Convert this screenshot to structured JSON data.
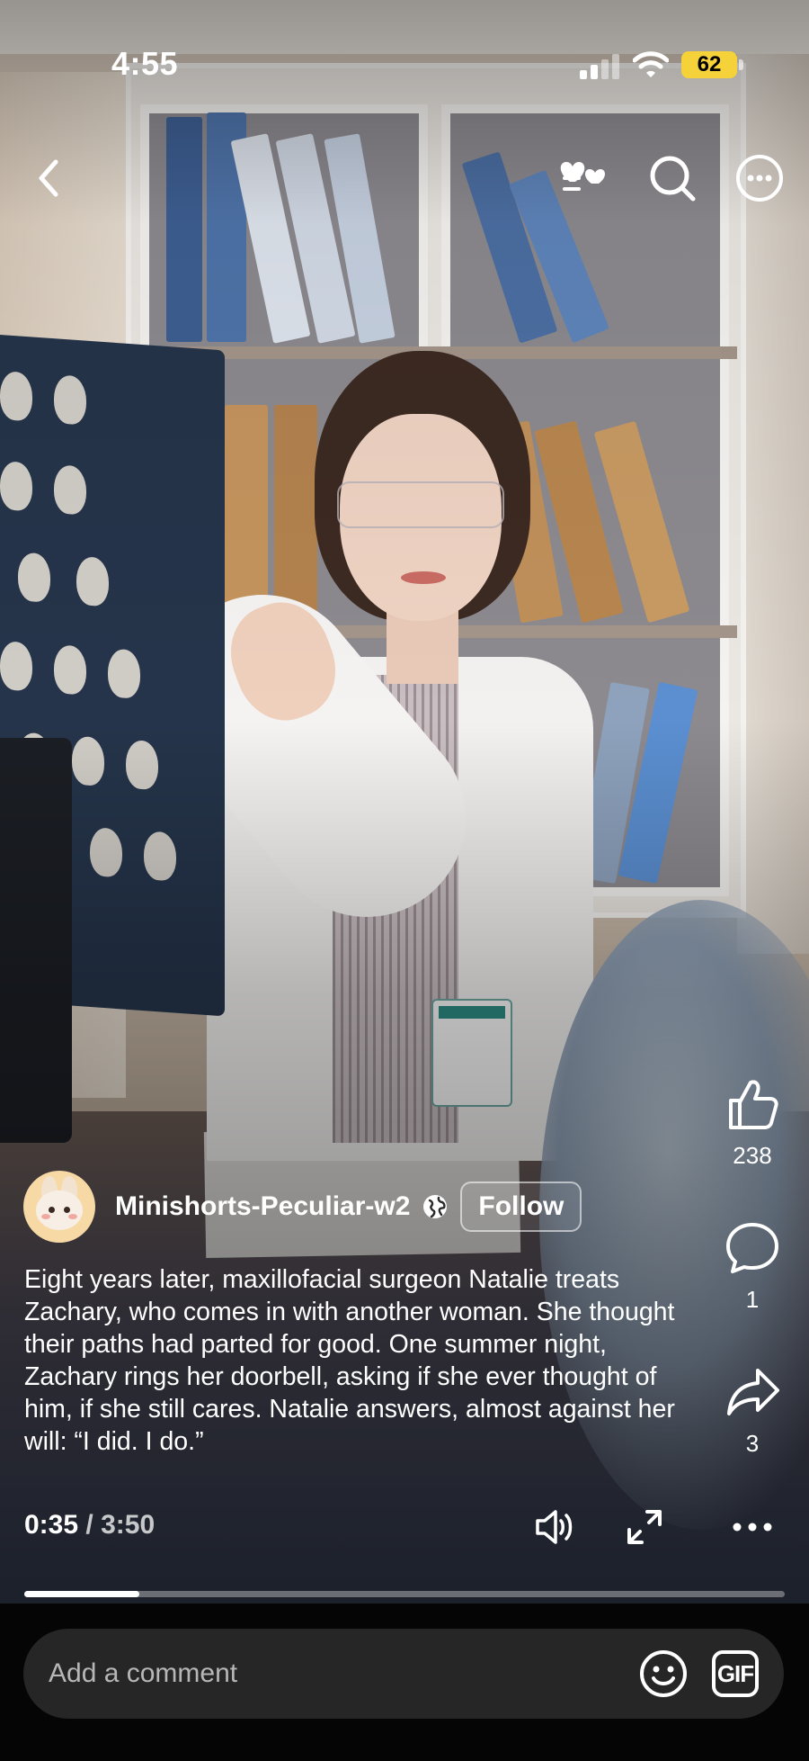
{
  "status_bar": {
    "time": "4:55",
    "battery": "62",
    "battery_color": "#f6d23a"
  },
  "nav": {
    "back_icon": "chevron-left-icon",
    "favorites_icon": "heart-list-icon",
    "search_icon": "search-icon",
    "more_icon": "more-circle-icon"
  },
  "author": {
    "name": "Minishorts-Peculiar-w2",
    "visibility_icon": "globe-icon",
    "follow_label": "Follow"
  },
  "caption": "Eight years later, maxillofacial surgeon Natalie treats Zachary, who comes in with another woman. She thought their paths had parted for good. One summer night, Zachary rings her doorbell, asking if she ever thought of him, if she still cares. Natalie answers, almost against her will: “I did. I do.”",
  "actions": {
    "likes": "238",
    "comments": "1",
    "shares": "3"
  },
  "player": {
    "current_time": "0:35",
    "separator": "/",
    "total_time": "3:50",
    "progress_fraction": 0.151
  },
  "comment_bar": {
    "placeholder": "Add a comment",
    "gif_label": "GIF"
  }
}
